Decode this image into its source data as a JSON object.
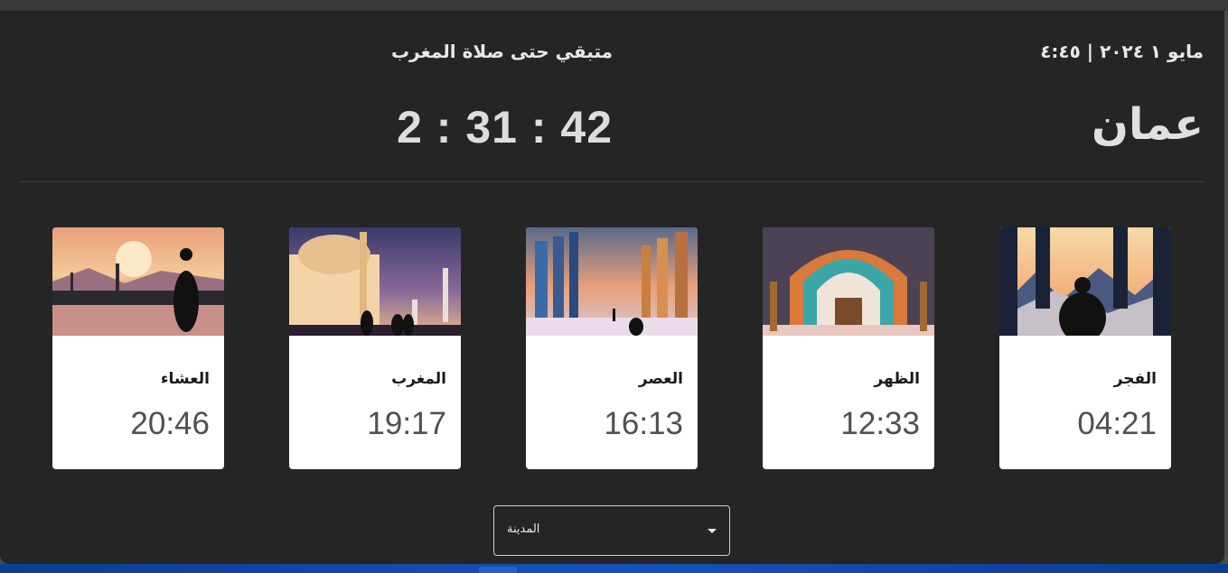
{
  "header": {
    "date": "مايو ١ ٢٠٢٤ | ٤:٤٥",
    "city": "عمان",
    "countdown_label": "متبقي حتى صلاة المغرب",
    "countdown": "2 : 31 : 42"
  },
  "prayers": [
    {
      "name": "الفجر",
      "time": "04:21",
      "image": "fajr-mountain-silhouette"
    },
    {
      "name": "الظهر",
      "time": "12:33",
      "image": "dhuhr-mosaic-archway"
    },
    {
      "name": "العصر",
      "time": "16:13",
      "image": "asr-colonnade-hall"
    },
    {
      "name": "المغرب",
      "time": "19:17",
      "image": "maghrib-mosque-dusk"
    },
    {
      "name": "العشاء",
      "time": "20:46",
      "image": "isha-sunset-skyline"
    }
  ],
  "city_select": {
    "label": "المدينة"
  },
  "colors": {
    "app_bg": "#252525",
    "card_bg": "#ffffff",
    "text_light": "#e8e8e8",
    "time_text": "#505050"
  }
}
